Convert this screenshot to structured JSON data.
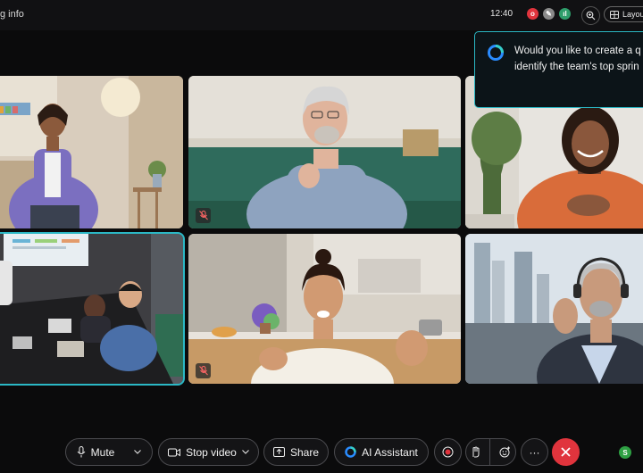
{
  "header": {
    "meeting_info_label": "g info",
    "time": "12:40",
    "layout_label": "Layou",
    "app_icons": [
      {
        "name": "record-app-icon",
        "color": "#e0343d",
        "glyph": "o"
      },
      {
        "name": "whiteboard-app-icon",
        "color": "#8a8a8a",
        "glyph": "✎"
      },
      {
        "name": "stats-app-icon",
        "color": "#2e9e6b",
        "glyph": "ıl"
      }
    ]
  },
  "notification": {
    "line1": "Would you like to create a q",
    "line2": "identify the team's top sprin"
  },
  "tiles": [
    {
      "name": "participant-tile-office-woman",
      "active": false,
      "muted": false
    },
    {
      "name": "participant-tile-older-man",
      "active": false,
      "muted": true
    },
    {
      "name": "participant-tile-woman-orange",
      "active": false,
      "muted": false
    },
    {
      "name": "participant-tile-conference-room",
      "active": true,
      "muted": false
    },
    {
      "name": "participant-tile-woman-kitchen",
      "active": false,
      "muted": true
    },
    {
      "name": "participant-tile-man-headset",
      "active": false,
      "muted": false
    }
  ],
  "controls": {
    "mute_label": "Mute",
    "stop_video_label": "Stop video",
    "share_label": "Share",
    "ai_assistant_label": "AI Assistant",
    "more_label": "···",
    "status_badge": "S"
  },
  "colors": {
    "accent": "#2bb8c5",
    "end_call": "#e0343d",
    "status": "#2ea043"
  }
}
